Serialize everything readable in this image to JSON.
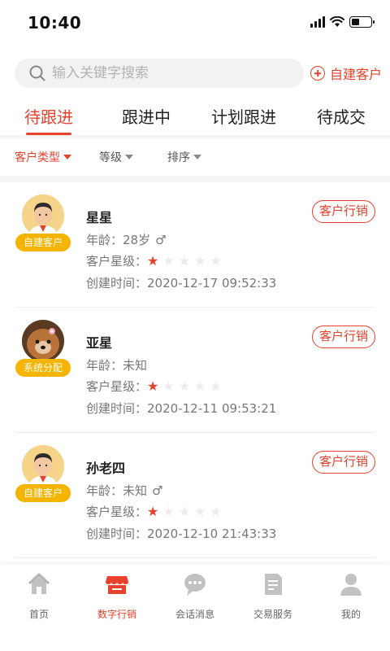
{
  "status_bar": {
    "time": "10:40"
  },
  "search": {
    "placeholder": "输入关键字搜索",
    "add_label": "自建客户"
  },
  "tabs": [
    {
      "label": "待跟进",
      "active": true
    },
    {
      "label": "跟进中",
      "active": false
    },
    {
      "label": "计划跟进",
      "active": false
    },
    {
      "label": "待成交",
      "active": false
    }
  ],
  "filters": [
    {
      "label": "客户类型",
      "active": true
    },
    {
      "label": "等级",
      "active": false
    },
    {
      "label": "排序",
      "active": false
    }
  ],
  "customers": [
    {
      "name": "星星",
      "source": "自建客户",
      "age_label": "年龄：",
      "age": "28岁",
      "gender": "♂",
      "star_label": "客户星级：",
      "stars": 1,
      "stars_max": 5,
      "created_label": "创建时间：",
      "created": "2020-12-17 09:52:33",
      "action": "客户行销",
      "avatar": "man-avatar-icon"
    },
    {
      "name": "亚星",
      "source": "系统分配",
      "age_label": "年龄：",
      "age": "未知",
      "gender": "",
      "star_label": "客户星级：",
      "stars": 1,
      "stars_max": 5,
      "created_label": "创建时间：",
      "created": "2020-12-11 09:53:21",
      "action": "客户行销",
      "avatar": "dog-avatar-icon"
    },
    {
      "name": "孙老四",
      "source": "自建客户",
      "age_label": "年龄：",
      "age": "未知",
      "gender": "♂",
      "star_label": "客户星级：",
      "stars": 1,
      "stars_max": 5,
      "created_label": "创建时间：",
      "created": "2020-12-10 21:43:33",
      "action": "客户行销",
      "avatar": "man-avatar-icon"
    }
  ],
  "nav": [
    {
      "label": "首页",
      "icon": "home-icon",
      "active": false
    },
    {
      "label": "数字行销",
      "icon": "store-icon",
      "active": true
    },
    {
      "label": "会话消息",
      "icon": "chat-icon",
      "active": false
    },
    {
      "label": "交易服务",
      "icon": "document-icon",
      "active": false
    },
    {
      "label": "我的",
      "icon": "user-icon",
      "active": false
    }
  ],
  "colors": {
    "accent": "#e8412c",
    "badge": "#f5b400"
  }
}
